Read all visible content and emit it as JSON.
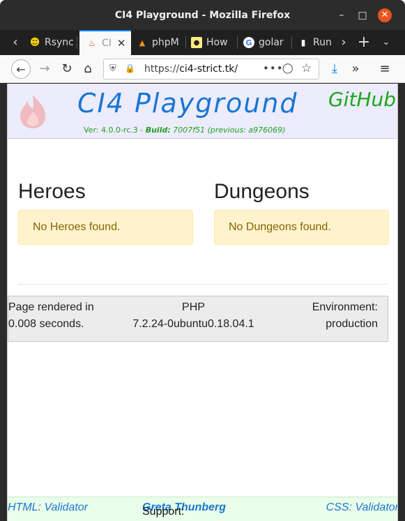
{
  "window": {
    "title": "CI4 Playground - Mozilla Firefox"
  },
  "tabs": [
    {
      "label": "Rsync",
      "favicon": "smiley-icon"
    },
    {
      "label": "CI",
      "favicon": "codeigniter-icon",
      "active": true
    },
    {
      "label": "phpM",
      "favicon": "phpmyadmin-icon"
    },
    {
      "label": "How",
      "favicon": "lightbulb-icon"
    },
    {
      "label": "golar",
      "favicon": "google-icon"
    },
    {
      "label": "Run",
      "favicon": "document-icon"
    }
  ],
  "navbar": {
    "url_prefix": "https://",
    "url_host": "ci4-strict.tk/"
  },
  "site": {
    "title": "CI4 Playground",
    "github": "GitHub",
    "ver_prefix": "Ver: 4.0.0-rc.3 - ",
    "build_label": "Build:",
    "build_value": " 7007f51 ",
    "previous": "(previous: a976069)"
  },
  "main": {
    "heroes_title": "Heroes",
    "heroes_empty": "No Heroes found.",
    "dungeons_title": "Dungeons",
    "dungeons_empty": "No Dungeons found."
  },
  "footer": {
    "rendered_line1": "Page rendered in",
    "rendered_line2": "0.008 seconds.",
    "php_label": "PHP",
    "php_version": "7.2.24-0ubuntu0.18.04.1",
    "env_label": "Environment:",
    "env_value": "production"
  },
  "bottombar": {
    "html_validator": "HTML: Validator",
    "support_label": "Support: ",
    "support_name": "Greta Thunberg",
    "css_validator": "CSS: Validator"
  },
  "colors": {
    "accent_blue": "#1976d2",
    "github_green": "#1ea51e",
    "header_bg": "#ececfc",
    "alert_bg": "#fff3cd",
    "tab_accent": "#0a84ff"
  }
}
